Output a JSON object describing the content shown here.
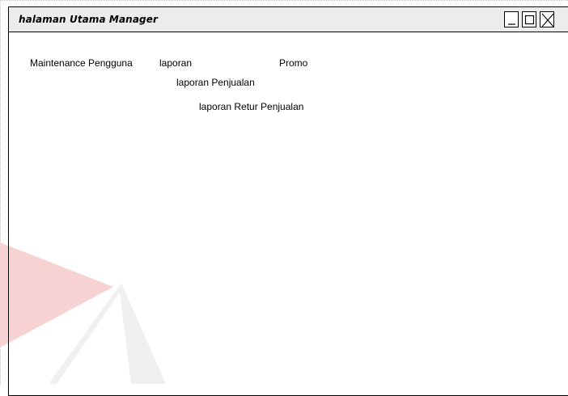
{
  "window": {
    "title": "halaman Utama Manager",
    "controls": {
      "minimize": "minimize-icon",
      "maximize": "maximize-icon",
      "close": "close-icon"
    }
  },
  "menu": {
    "maintenance": "Maintenance Pengguna",
    "laporan": "laporan",
    "promo": "Promo",
    "laporan_submenu": [
      "laporan Penjualan",
      "laporan Retur Penjualan"
    ]
  },
  "colors": {
    "titlebar": "#ececec",
    "border": "#000000",
    "watermark_red": "#f5c9c9",
    "watermark_gray": "#e6e6e6"
  }
}
